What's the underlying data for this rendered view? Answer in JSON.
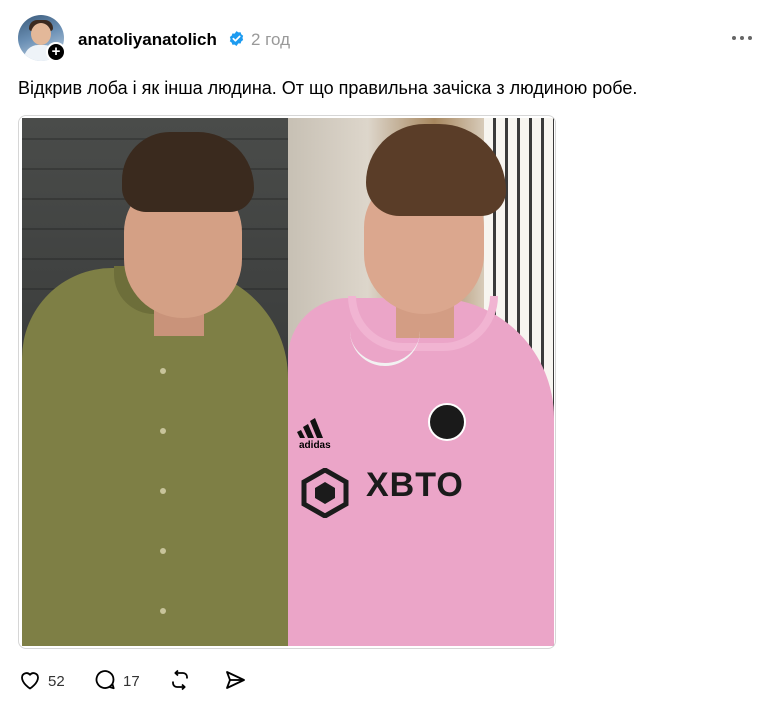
{
  "post": {
    "author": {
      "username": "anatoliyanatolich",
      "verified": true,
      "time_ago": "2 год"
    },
    "caption": "Відкрив лоба і як інша людина. От що правильна зачіска з людиною робе.",
    "media": {
      "left_panel": "person in olive green button-up shirt against dark brick wall",
      "right_panel": "person in pink football jersey with chain necklace",
      "jersey_brand_text": "adidas",
      "jersey_sponsor_text": "XBTO"
    },
    "actions": {
      "likes": "52",
      "comments": "17"
    }
  },
  "colors": {
    "verified_badge": "#1d9bf0",
    "timestamp": "#999999",
    "text": "#000000",
    "jersey_pink": "#eba5c8",
    "shirt_olive": "#7e7f45"
  },
  "icons": {
    "more": "more-horizontal-icon",
    "like": "heart-icon",
    "comment": "comment-bubble-icon",
    "repost": "repost-icon",
    "share": "send-icon",
    "follow": "plus-icon",
    "verified": "verified-check-icon"
  }
}
